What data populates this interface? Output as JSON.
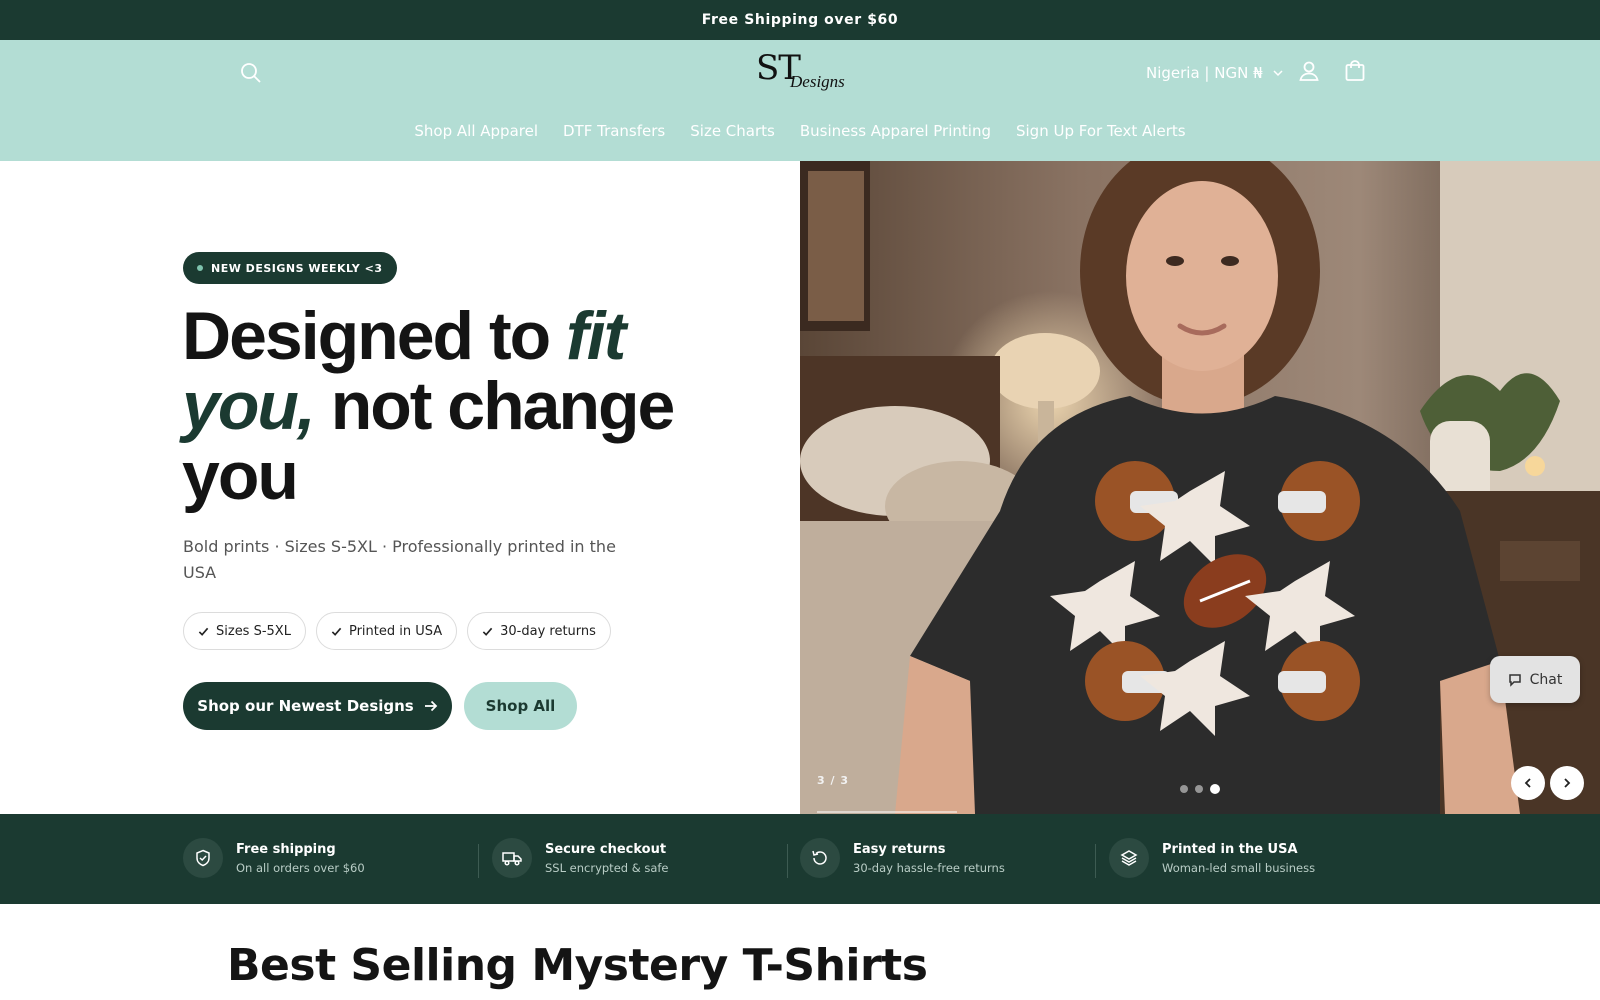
{
  "announcement": {
    "text": "Free Shipping over $60"
  },
  "header": {
    "logo": {
      "main": "ST",
      "script": "Designs"
    },
    "locale": "Nigeria | NGN ₦",
    "icons": {
      "search": "search-icon",
      "account": "account-icon",
      "cart": "cart-icon"
    },
    "nav": [
      {
        "label": "Shop All Apparel"
      },
      {
        "label": "DTF Transfers"
      },
      {
        "label": "Size Charts"
      },
      {
        "label": "Business Apparel Printing"
      },
      {
        "label": "Sign Up For Text Alerts"
      }
    ]
  },
  "hero": {
    "badge": "NEW DESIGNS WEEKLY <3",
    "headline": {
      "part1": "Designed to ",
      "italic1": "fit",
      "italic2": "you,",
      "part2": " not change you"
    },
    "subtext": "Bold prints · Sizes S-5XL · Professionally printed in the USA",
    "chips": [
      {
        "label": "Sizes S-5XL"
      },
      {
        "label": "Printed in USA"
      },
      {
        "label": "30-day returns"
      }
    ],
    "cta_primary": "Shop our Newest Designs",
    "cta_secondary": "Shop All",
    "slide_counter": "3 / 3",
    "slide_active": 3,
    "slide_total": 3,
    "chat_label": "Chat"
  },
  "trust": [
    {
      "title": "Free shipping",
      "subtitle": "On all orders over $60",
      "icon": "shield-icon"
    },
    {
      "title": "Secure checkout",
      "subtitle": "SSL encrypted & safe",
      "icon": "truck-icon"
    },
    {
      "title": "Easy returns",
      "subtitle": "30-day hassle-free returns",
      "icon": "return-icon"
    },
    {
      "title": "Printed in the USA",
      "subtitle": "Woman-led small business",
      "icon": "layers-icon"
    }
  ],
  "section": {
    "title": "Best Selling Mystery T-Shirts"
  },
  "colors": {
    "brand_dark": "#1b3a31",
    "brand_mint": "#b3ddd4",
    "white": "#ffffff"
  }
}
